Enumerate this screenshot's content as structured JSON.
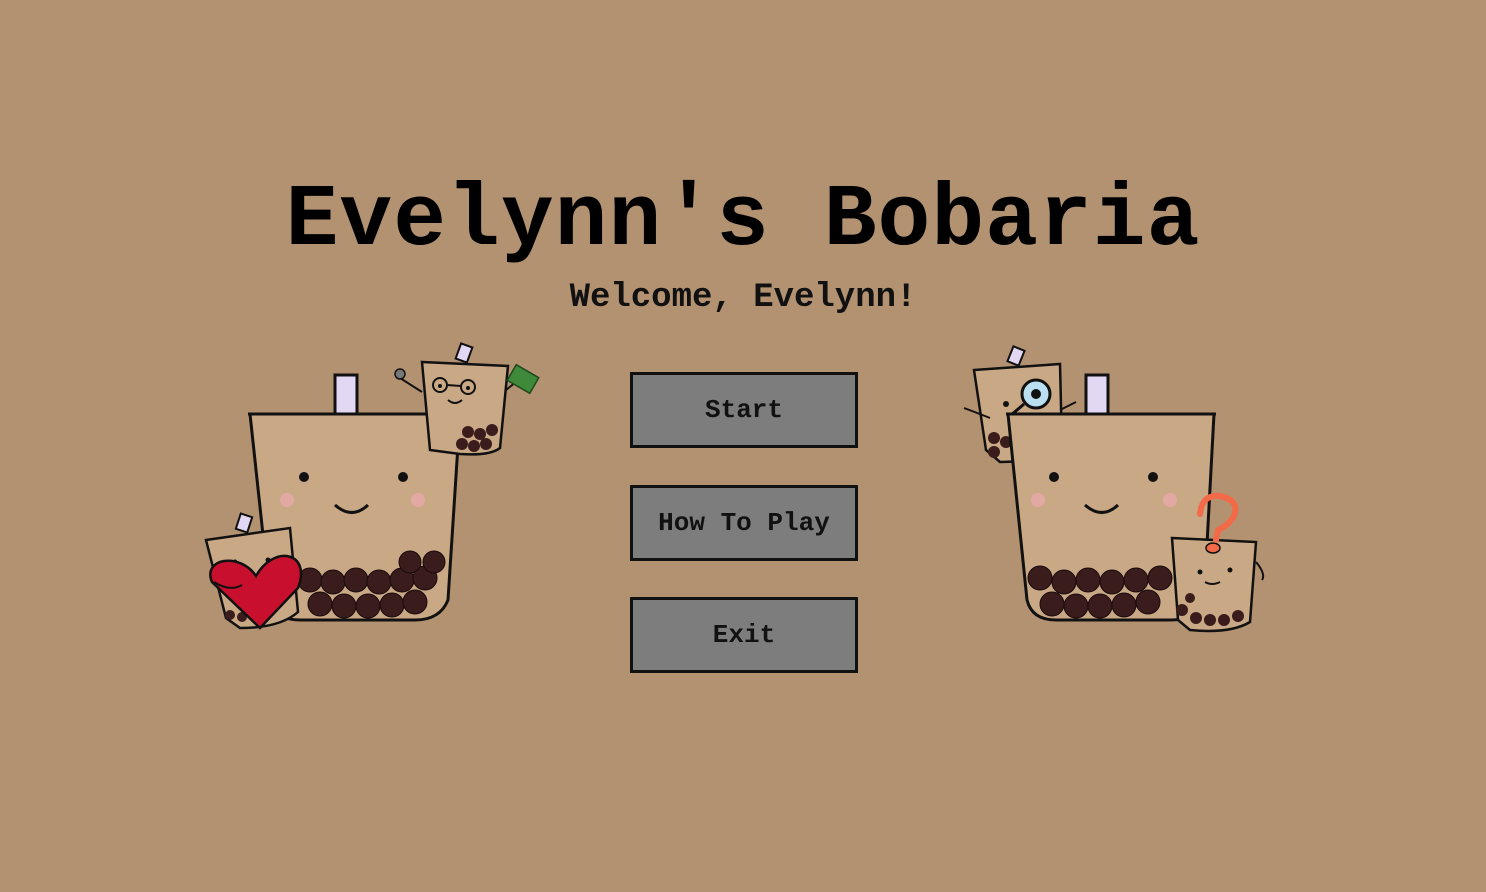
{
  "title": "Evelynn's Bobaria",
  "subtitle": "Welcome, Evelynn!",
  "menu": {
    "start_label": "Start",
    "how_to_play_label": "How To Play",
    "exit_label": "Exit"
  },
  "colors": {
    "background": "#b39272",
    "button_fill": "#7d7d7d",
    "button_border": "#111111",
    "cup_fill": "#c9a886",
    "boba": "#3a1c1c",
    "straw": "#e2d8f3",
    "heart": "#c8102e",
    "question_mark": "#f26a47",
    "money": "#3f8a3a",
    "magnifier": "#b9dff0"
  },
  "decorations": [
    "big-boba-cup-left",
    "boba-with-glasses-and-money",
    "boba-holding-heart",
    "big-boba-cup-right",
    "boba-with-magnifying-glass",
    "boba-with-question-mark"
  ]
}
